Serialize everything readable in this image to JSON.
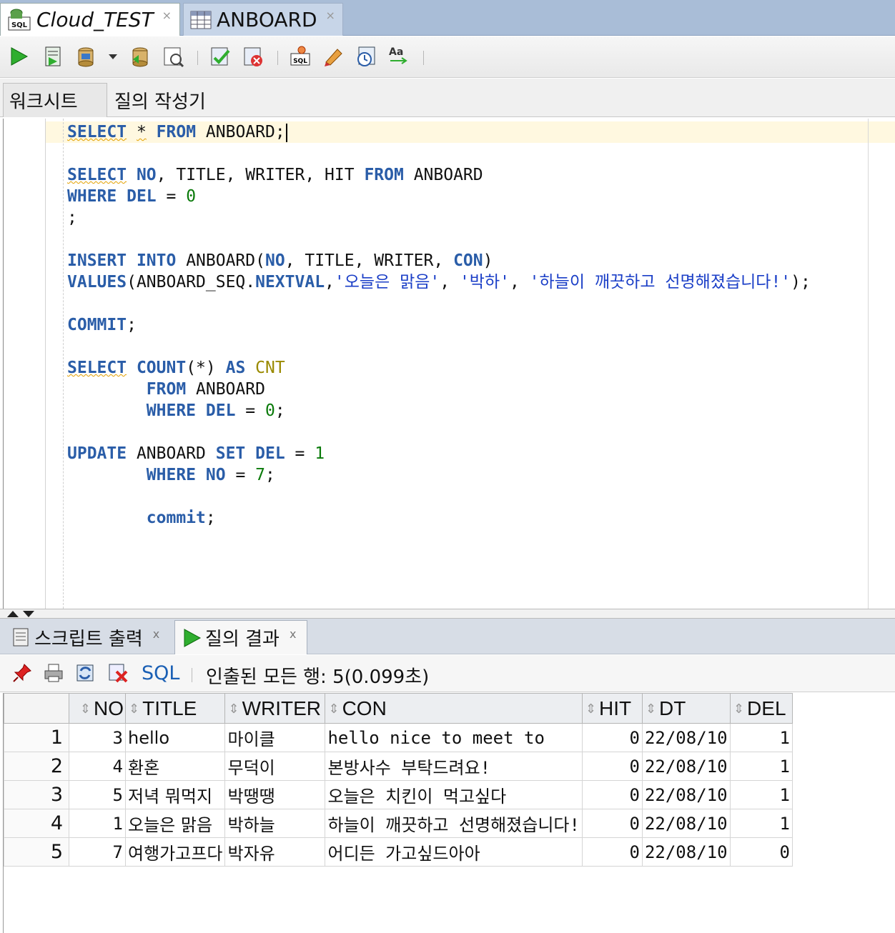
{
  "doc_tabs": [
    {
      "label": "Cloud_TEST",
      "icon": "sql-connection-icon",
      "close": "×"
    },
    {
      "label": "ANBOARD",
      "icon": "table-icon",
      "close": "×"
    }
  ],
  "toolbar": {
    "icons": [
      "run-statement-icon",
      "run-script-icon",
      "commit-icon",
      "dropdown-arrow-icon",
      "rollback-icon",
      "explain-plan-icon",
      "autotrace-icon",
      "sql-tuning-icon",
      "monitor-icon",
      "unshared-sql-icon",
      "clear-icon",
      "history-icon",
      "case-format-icon"
    ]
  },
  "sub_tabs": [
    "워크시트",
    "질의 작성기"
  ],
  "editor": {
    "lines": [
      {
        "tokens": [
          {
            "t": "SELECT",
            "c": "kw sq"
          },
          {
            "t": " "
          },
          {
            "t": "*",
            "c": "sq"
          },
          {
            "t": " "
          },
          {
            "t": "FROM",
            "c": "kw"
          },
          {
            "t": " ANBOARD;"
          }
        ]
      },
      {
        "tokens": [
          {
            "t": "SELECT",
            "c": "kw sq"
          },
          {
            "t": " "
          },
          {
            "t": "NO",
            "c": "kw"
          },
          {
            "t": ", TITLE, WRITER, HIT "
          },
          {
            "t": "FROM",
            "c": "kw"
          },
          {
            "t": " ANBOARD"
          }
        ]
      },
      {
        "tokens": [
          {
            "t": "WHERE",
            "c": "kw"
          },
          {
            "t": " "
          },
          {
            "t": "DEL",
            "c": "kw"
          },
          {
            "t": " = "
          },
          {
            "t": "0",
            "c": "num"
          }
        ]
      },
      {
        "tokens": [
          {
            "t": ";"
          }
        ]
      },
      {
        "tokens": [
          {
            "t": "INSERT",
            "c": "kw"
          },
          {
            "t": " "
          },
          {
            "t": "INTO",
            "c": "kw"
          },
          {
            "t": " ANBOARD("
          },
          {
            "t": "NO",
            "c": "kw"
          },
          {
            "t": ", TITLE, WRITER, "
          },
          {
            "t": "CON",
            "c": "kw"
          },
          {
            "t": ")"
          }
        ]
      },
      {
        "tokens": [
          {
            "t": "VALUES",
            "c": "kw"
          },
          {
            "t": "(ANBOARD_SEQ."
          },
          {
            "t": "NEXTVAL",
            "c": "kw"
          },
          {
            "t": ","
          },
          {
            "t": "'오늘은 맑음'",
            "c": "str"
          },
          {
            "t": ", "
          },
          {
            "t": "'박하'",
            "c": "str"
          },
          {
            "t": ", "
          },
          {
            "t": "'하늘이 깨끗하고 선명해졌습니다!'",
            "c": "str"
          },
          {
            "t": ");"
          }
        ]
      },
      {
        "tokens": [
          {
            "t": "COMMIT",
            "c": "kw"
          },
          {
            "t": ";"
          }
        ]
      },
      {
        "tokens": [
          {
            "t": "SELECT",
            "c": "kw sq"
          },
          {
            "t": " "
          },
          {
            "t": "COUNT",
            "c": "fn"
          },
          {
            "t": "(*) "
          },
          {
            "t": "AS",
            "c": "kw"
          },
          {
            "t": " "
          },
          {
            "t": "CNT",
            "c": "al"
          }
        ]
      },
      {
        "tokens": [
          {
            "t": "        "
          },
          {
            "t": "FROM",
            "c": "kw"
          },
          {
            "t": " ANBOARD"
          }
        ]
      },
      {
        "tokens": [
          {
            "t": "        "
          },
          {
            "t": "WHERE",
            "c": "kw"
          },
          {
            "t": " "
          },
          {
            "t": "DEL",
            "c": "kw"
          },
          {
            "t": " = "
          },
          {
            "t": "0",
            "c": "num"
          },
          {
            "t": ";"
          }
        ]
      },
      {
        "tokens": [
          {
            "t": "UPDATE",
            "c": "kw"
          },
          {
            "t": " ANBOARD "
          },
          {
            "t": "SET",
            "c": "kw"
          },
          {
            "t": " "
          },
          {
            "t": "DEL",
            "c": "kw"
          },
          {
            "t": " = "
          },
          {
            "t": "1",
            "c": "num"
          }
        ]
      },
      {
        "tokens": [
          {
            "t": "        "
          },
          {
            "t": "WHERE",
            "c": "kw"
          },
          {
            "t": " "
          },
          {
            "t": "NO",
            "c": "kw"
          },
          {
            "t": " = "
          },
          {
            "t": "7",
            "c": "num"
          },
          {
            "t": ";"
          }
        ]
      },
      {
        "tokens": [
          {
            "t": "        "
          },
          {
            "t": "commit",
            "c": "kw"
          },
          {
            "t": ";"
          }
        ]
      }
    ]
  },
  "bottom_tabs": [
    {
      "label": "스크립트 출력",
      "icon": "script-output-icon",
      "close": "x"
    },
    {
      "label": "질의 결과",
      "icon": "query-result-icon",
      "close": "x"
    }
  ],
  "result_toolbar": {
    "icons": [
      "pin-icon",
      "print-icon",
      "refresh-icon",
      "cancel-icon"
    ],
    "sql_label": "SQL",
    "status": "인출된 모든 행: 5(0.099초)"
  },
  "results": {
    "columns": [
      "NO",
      "TITLE",
      "WRITER",
      "CON",
      "HIT",
      "DT",
      "DEL"
    ],
    "rows": [
      {
        "rn": "1",
        "NO": "3",
        "TITLE": "hello",
        "WRITER": "마이클",
        "CON": "hello nice to meet to",
        "HIT": "0",
        "DT": "22/08/10",
        "DEL": "1"
      },
      {
        "rn": "2",
        "NO": "4",
        "TITLE": "환혼",
        "WRITER": "무덕이",
        "CON": "본방사수 부탁드려요!",
        "HIT": "0",
        "DT": "22/08/10",
        "DEL": "1"
      },
      {
        "rn": "3",
        "NO": "5",
        "TITLE": "저녁 뭐먹지",
        "WRITER": "박땡땡",
        "CON": "오늘은 치킨이 먹고싶다",
        "HIT": "0",
        "DT": "22/08/10",
        "DEL": "1"
      },
      {
        "rn": "4",
        "NO": "1",
        "TITLE": "오늘은 맑음",
        "WRITER": "박하늘",
        "CON": "하늘이 깨끗하고 선명해졌습니다!",
        "HIT": "0",
        "DT": "22/08/10",
        "DEL": "1"
      },
      {
        "rn": "5",
        "NO": "7",
        "TITLE": "여행가고프다",
        "WRITER": "박자유",
        "CON": "어디든 가고싶드아아",
        "HIT": "0",
        "DT": "22/08/10",
        "DEL": "0"
      }
    ]
  }
}
